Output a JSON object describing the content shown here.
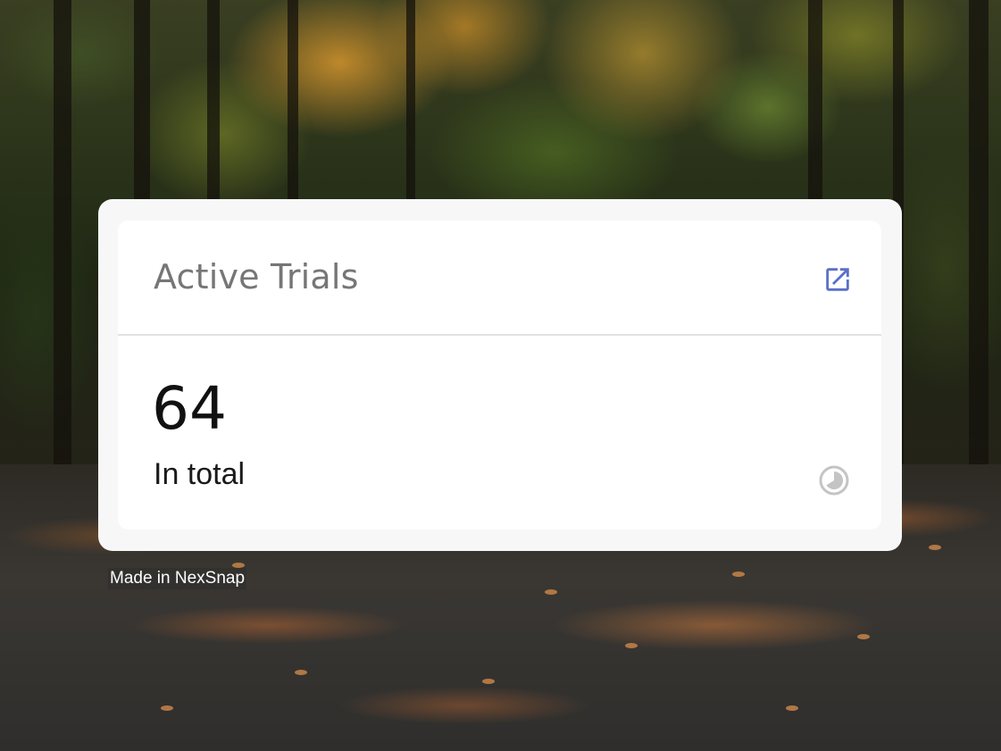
{
  "widget": {
    "title": "Active Trials",
    "value": "64",
    "label": "In total",
    "open_icon": "open-in-new-icon",
    "status_icon": "progress-clock-icon",
    "accent_color": "#5b6fc9",
    "icon_muted_color": "#c4c4c4"
  },
  "footer": {
    "credit": "Made in NexSnap"
  }
}
